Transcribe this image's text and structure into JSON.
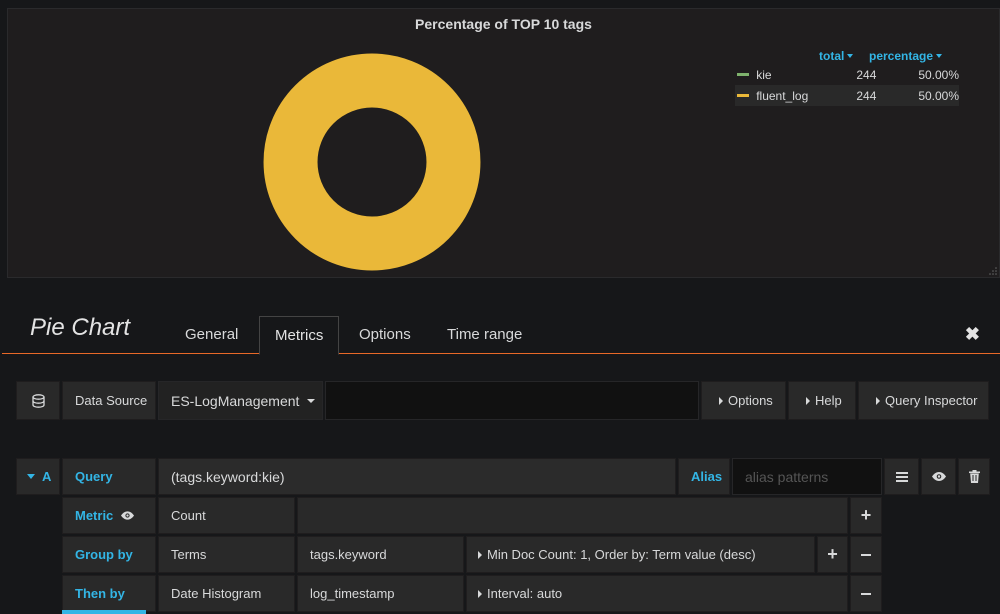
{
  "panel": {
    "title": "Percentage of TOP 10 tags",
    "legend": {
      "col_total": "total",
      "col_percentage": "percentage",
      "rows": [
        {
          "name": "kie",
          "total": "244",
          "percentage": "50.00%",
          "color": "#7eb26d"
        },
        {
          "name": "fluent_log",
          "total": "244",
          "percentage": "50.00%",
          "color": "#eab839"
        }
      ]
    }
  },
  "chart_data": {
    "type": "pie",
    "title": "Percentage of TOP 10 tags",
    "categories": [
      "kie",
      "fluent_log"
    ],
    "values": [
      244,
      244
    ],
    "colors": [
      "#7eb26d",
      "#eab839"
    ],
    "donut": true
  },
  "editor": {
    "title": "Pie Chart",
    "tabs": [
      "General",
      "Metrics",
      "Options",
      "Time range"
    ],
    "active_tab": "Metrics"
  },
  "datasource": {
    "label": "Data Source",
    "value": "ES-LogManagement",
    "options_label": "Options",
    "help_label": "Help",
    "inspector_label": "Query Inspector"
  },
  "query": {
    "ref_id": "A",
    "query_label": "Query",
    "query_value": "(tags.keyword:kie)",
    "alias_label": "Alias",
    "alias_placeholder": "alias patterns",
    "metric_label": "Metric",
    "metric_value": "Count",
    "groupby_label": "Group by",
    "groupby_type": "Terms",
    "groupby_field": "tags.keyword",
    "groupby_settings": "Min Doc Count: 1, Order by: Term value (desc)",
    "thenby_label": "Then by",
    "thenby_type": "Date Histogram",
    "thenby_field": "log_timestamp",
    "thenby_settings": "Interval: auto"
  },
  "colors": {
    "accent": "#33b5e5",
    "tab_underline": "#e86928"
  }
}
